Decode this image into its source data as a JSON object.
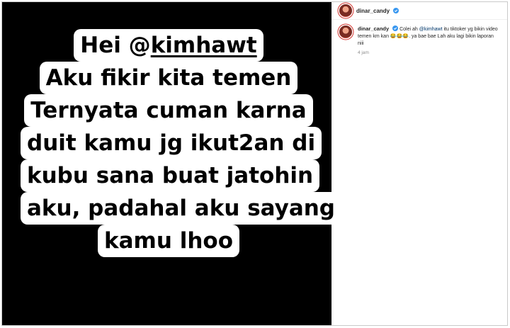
{
  "post": {
    "image_text": {
      "l1_a": "Hei @",
      "l1_b": "kimhawt",
      "l2": "Aku fikir kita temen",
      "l3": "Ternyata cuman karna",
      "l4": "duit kamu jg ikut2an di",
      "l5": "kubu sana buat jatohin",
      "l6": "aku, padahal aku sayang",
      "l7": "kamu lhoo"
    }
  },
  "header": {
    "username": "dinar_candy"
  },
  "comment": {
    "username": "dinar_candy",
    "text_a": " Colei ah ",
    "mention": "@kimhawt",
    "text_b": " itu tiktoker yg bikin video temen km kan ",
    "emoji": "😂😂😂",
    "text_c": ". ya bae bae Lah aku lagi bikin laporan niii",
    "time": "4 jam"
  },
  "colors": {
    "verified": "#3897f0",
    "mention": "#00376b"
  }
}
